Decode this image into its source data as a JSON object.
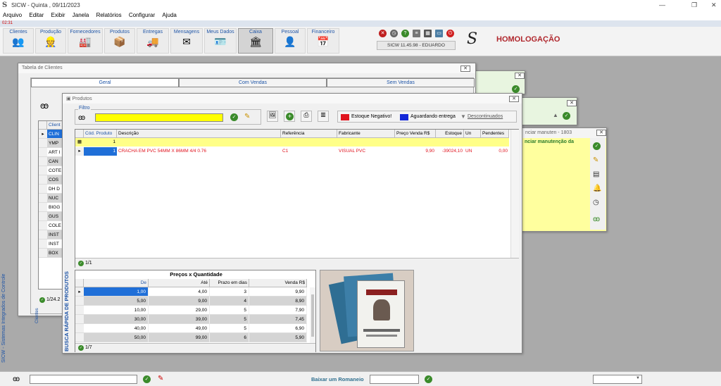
{
  "window": {
    "title": "SICW - Quinta , 09/11/2023",
    "app_icon": "S"
  },
  "menu": [
    "Arquivo",
    "Editar",
    "Exibir",
    "Janela",
    "Relatórios",
    "Configurar",
    "Ajuda"
  ],
  "clock": "02:31",
  "toolbar": {
    "buttons": [
      {
        "label": "Clientes",
        "icon": "clients-icon"
      },
      {
        "label": "Produção",
        "icon": "production-icon"
      },
      {
        "label": "Fornecedores",
        "icon": "suppliers-icon"
      },
      {
        "label": "Produtos",
        "icon": "products-icon"
      },
      {
        "label": "Entregas",
        "icon": "deliveries-icon"
      },
      {
        "label": "Mensagens",
        "icon": "messages-icon"
      },
      {
        "label": "Meus Dados",
        "icon": "my-data-icon"
      },
      {
        "label": "Caixa",
        "icon": "cash-icon"
      },
      {
        "label": "Pessoal",
        "icon": "personal-icon"
      },
      {
        "label": "Financeiro",
        "icon": "finance-icon"
      }
    ],
    "version": "SICW 11.45.98 - EDUARDO",
    "environment": "HOMOLOGAÇÃO",
    "logo": "S"
  },
  "clientes_window": {
    "title": "Tabela de Clientes",
    "tabs": [
      "Geral",
      "Com Vendas",
      "Sem Vendas"
    ],
    "column": "Client",
    "rows": [
      "CLIN",
      "YMP",
      "ART I",
      "CAN",
      "COTE",
      "COS",
      "DH D",
      "NUC",
      "BIGG",
      "GUS",
      "COLE",
      "INST",
      "INST",
      "BOX"
    ],
    "footer": "1/24.2",
    "side_label": "Clientes"
  },
  "manutencao_window": {
    "title": "nciar manuten - 1803",
    "link": "nciar manutenção da"
  },
  "produtos_window": {
    "title": "Produtos",
    "filter_label": "Filtro",
    "legend": {
      "negative": "Estoque Negativo!",
      "awaiting": "Aguardando entrega",
      "discontinued": "Descontinuados"
    },
    "columns": [
      "Cód. Produto",
      "Descrição",
      "Referência",
      "Fabricante",
      "Preço Venda R$",
      "Estoque",
      "Un",
      "Pendentes"
    ],
    "filter_row_code": "1",
    "rows": [
      {
        "code": "1",
        "description": "CRACHA EM PVC 54MM X 86MM 4/4 0.76",
        "reference": "C1",
        "manufacturer": "VISUAL PVC",
        "price": "9,90",
        "stock": "-39024,10",
        "unit": "UN",
        "pending": "0,00"
      }
    ],
    "footer": "1/1",
    "side_label": "BUSCA RÁPIDA DE PRODUTOS",
    "prices": {
      "title": "Preços x Quantidade",
      "columns": [
        "De",
        "Até",
        "Prazo em dias",
        "Venda R$"
      ],
      "rows": [
        [
          "1,00",
          "4,00",
          "3",
          "9,90"
        ],
        [
          "5,00",
          "9,00",
          "4",
          "8,90"
        ],
        [
          "10,00",
          "29,00",
          "5",
          "7,90"
        ],
        [
          "30,00",
          "39,00",
          "5",
          "7,45"
        ],
        [
          "40,00",
          "49,00",
          "5",
          "6,90"
        ],
        [
          "50,00",
          "99,00",
          "6",
          "5,90"
        ]
      ],
      "footer": "1/7"
    }
  },
  "statusbar": {
    "romaneio_label": "Baixar um Romaneio"
  },
  "side_text": "SICW - Sistemas Integrados de Controle",
  "colors": {
    "negative": "#e0141e",
    "awaiting": "#1428d8",
    "accent": "#1f55a7",
    "highlight_yellow": "#ffff00"
  }
}
